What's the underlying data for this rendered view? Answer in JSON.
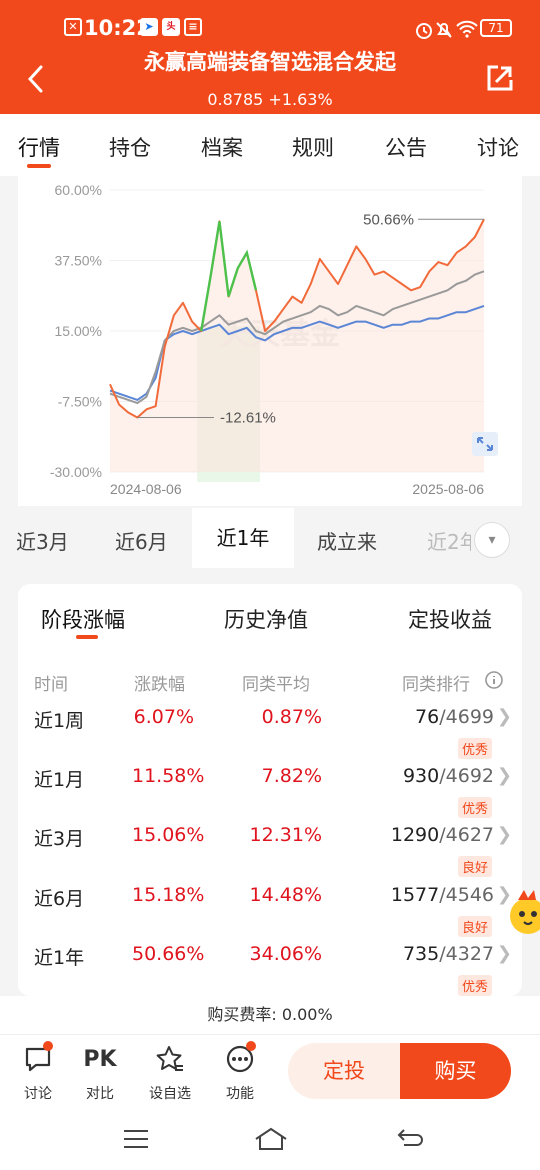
{
  "status_bar": {
    "time": "10:22",
    "battery": "71"
  },
  "header": {
    "title": "永赢高端装备智选混合发起",
    "nav_line": "0.8785  +1.63%"
  },
  "tabs": [
    "行情",
    "持仓",
    "档案",
    "规则",
    "公告",
    "讨论"
  ],
  "chart_data": {
    "type": "line",
    "x_start_label": "2024-08-06",
    "x_end_label": "2025-08-06",
    "y_ticks": [
      "60.00%",
      "37.50%",
      "15.00%",
      "-7.50%",
      "-30.00%"
    ],
    "ylim": [
      -30,
      60
    ],
    "max_label": "50.66%",
    "min_label": "-12.61%",
    "watermark": "天天基金",
    "series": [
      {
        "role": "fund",
        "color": "#f26a3a",
        "values": [
          -2.0,
          -8.5,
          -11.0,
          -12.6,
          -10.0,
          -9.0,
          10.0,
          20.0,
          24.0,
          18.0,
          15.0,
          32.0,
          50.0,
          26.0,
          35.0,
          40.0,
          28.0,
          15.0,
          18.0,
          22.0,
          26.0,
          24.0,
          30.0,
          38.0,
          34.0,
          30.0,
          36.0,
          42.0,
          38.0,
          33.0,
          34.0,
          32.0,
          30.0,
          28.0,
          29.0,
          34.0,
          37.0,
          36.0,
          40.0,
          42.0,
          45.0,
          50.66
        ]
      },
      {
        "role": "similar_avg",
        "color": "#9a9a9a",
        "values": [
          -5.0,
          -6.0,
          -7.0,
          -8.0,
          -6.0,
          2.0,
          12.0,
          15.0,
          16.0,
          15.0,
          16.0,
          18.0,
          20.0,
          17.0,
          18.0,
          19.0,
          15.0,
          14.0,
          16.0,
          18.0,
          19.0,
          20.0,
          21.0,
          23.0,
          22.0,
          20.0,
          21.0,
          23.0,
          22.0,
          21.0,
          20.0,
          22.0,
          23.0,
          24.0,
          25.0,
          26.0,
          27.0,
          28.0,
          30.0,
          31.0,
          33.0,
          34.06
        ]
      },
      {
        "role": "benchmark",
        "color": "#5b86d6",
        "values": [
          -4.0,
          -5.0,
          -6.0,
          -7.0,
          -5.0,
          0.0,
          12.0,
          14.0,
          15.0,
          14.0,
          15.0,
          16.0,
          17.0,
          14.0,
          15.0,
          16.0,
          13.0,
          12.0,
          14.0,
          15.0,
          16.0,
          16.0,
          17.0,
          18.0,
          17.0,
          16.0,
          17.0,
          18.0,
          18.0,
          17.0,
          16.0,
          17.0,
          17.0,
          18.0,
          18.0,
          19.0,
          19.0,
          20.0,
          21.0,
          21.0,
          22.0,
          23.0
        ]
      }
    ],
    "highlight_range": [
      10,
      16
    ]
  },
  "periods": [
    "近3月",
    "近6月",
    "近1年",
    "成立来",
    "近2年"
  ],
  "perf_tabs": [
    "阶段涨幅",
    "历史净值",
    "定投收益"
  ],
  "table": {
    "headers": [
      "时间",
      "涨跌幅",
      "同类平均",
      "同类排行"
    ],
    "rows": [
      {
        "period": "近1周",
        "change": "6.07%",
        "avg": "0.87%",
        "rank": "76",
        "total": "/4699",
        "badge": "优秀"
      },
      {
        "period": "近1月",
        "change": "11.58%",
        "avg": "7.82%",
        "rank": "930",
        "total": "/4692",
        "badge": "优秀"
      },
      {
        "period": "近3月",
        "change": "15.06%",
        "avg": "12.31%",
        "rank": "1290",
        "total": "/4627",
        "badge": "良好"
      },
      {
        "period": "近6月",
        "change": "15.18%",
        "avg": "14.48%",
        "rank": "1577",
        "total": "/4546",
        "badge": "良好"
      },
      {
        "period": "近1年",
        "change": "50.66%",
        "avg": "34.06%",
        "rank": "735",
        "total": "/4327",
        "badge": "优秀"
      }
    ]
  },
  "fee": "购买费率: 0.00%",
  "bottom": {
    "items": [
      "讨论",
      "对比",
      "设自选",
      "功能"
    ],
    "pk": "PK",
    "dingtou": "定投",
    "buy": "购买"
  },
  "colors": {
    "brand": "#f2491c",
    "up": "#e0141e",
    "green": "#4cc24c"
  }
}
